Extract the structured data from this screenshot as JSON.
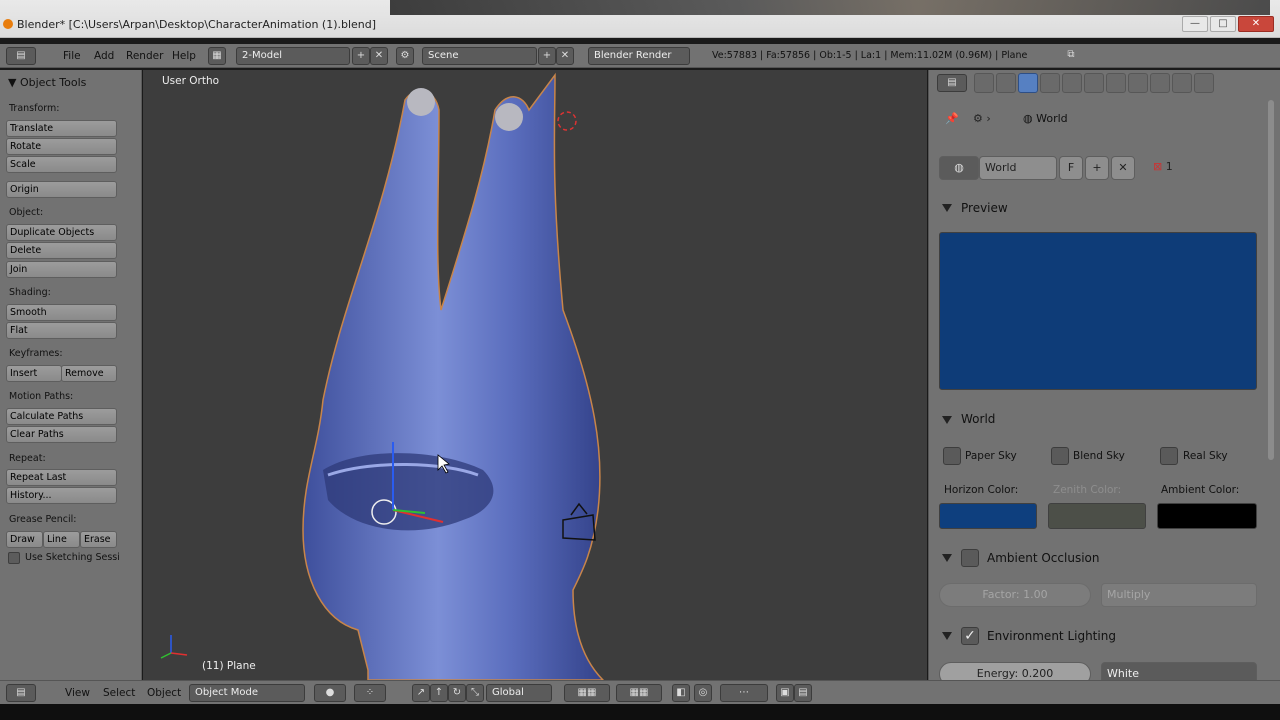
{
  "window": {
    "title": "Blender* [C:\\Users\\Arpan\\Desktop\\CharacterAnimation (1).blend]",
    "min": "—",
    "max": "□",
    "close": "✕"
  },
  "info_header": {
    "menus": [
      "File",
      "Add",
      "Render",
      "Help"
    ],
    "screen_layout": "2-Model",
    "scene": "Scene",
    "engine": "Blender Render",
    "stats": "Ve:57883 | Fa:57856 | Ob:1-5 | La:1 | Mem:11.02M (0.96M) | Plane"
  },
  "tool_shelf": {
    "title": "Object Tools",
    "transform_label": "Transform:",
    "translate": "Translate",
    "rotate": "Rotate",
    "scale": "Scale",
    "origin": "Origin",
    "object_label": "Object:",
    "duplicate": "Duplicate Objects",
    "delete": "Delete",
    "join": "Join",
    "shading_label": "Shading:",
    "smooth": "Smooth",
    "flat": "Flat",
    "keyframes_label": "Keyframes:",
    "insert": "Insert",
    "remove": "Remove",
    "motion_label": "Motion Paths:",
    "calc_paths": "Calculate Paths",
    "clear_paths": "Clear Paths",
    "repeat_label": "Repeat:",
    "repeat_last": "Repeat Last",
    "history": "History...",
    "grease_label": "Grease Pencil:",
    "draw": "Draw",
    "line": "Line",
    "erase": "Erase",
    "sketching": "Use Sketching Sessi"
  },
  "viewport": {
    "view_label": "User Ortho",
    "object_label": "(11) Plane"
  },
  "bottom_header": {
    "view": "View",
    "select": "Select",
    "object": "Object",
    "mode": "Object Mode",
    "orientation": "Global"
  },
  "properties": {
    "breadcrumb": "World",
    "world_name": "World",
    "fake_user": "F",
    "users": "1",
    "preview_title": "Preview",
    "preview_color": "#0e3c78",
    "world_title": "World",
    "paper_sky": "Paper Sky",
    "blend_sky": "Blend Sky",
    "real_sky": "Real Sky",
    "horizon_label": "Horizon Color:",
    "zenith_label": "Zenith Color:",
    "ambient_label": "Ambient Color:",
    "horizon_color": "#0e3f7e",
    "zenith_color": "#4c4f48",
    "ambient_color": "#000000",
    "ao_title": "Ambient Occlusion",
    "ao_factor": "Factor: 1.00",
    "ao_blend": "Multiply",
    "env_title": "Environment Lighting",
    "energy": "Energy: 0.200",
    "env_color": "White"
  }
}
